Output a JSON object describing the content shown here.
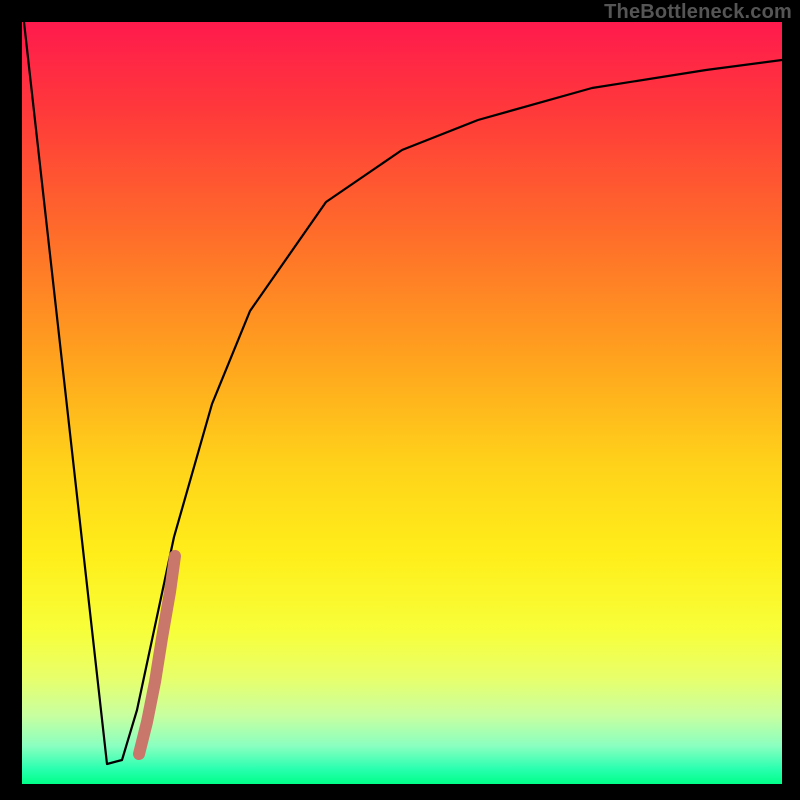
{
  "branding": "TheBottleneck.com",
  "chart_data": {
    "type": "line",
    "title": "",
    "xlabel": "",
    "ylabel": "",
    "xlim": [
      0,
      100
    ],
    "ylim": [
      0,
      100
    ],
    "series": [
      {
        "name": "bottleneck-curve",
        "x": [
          0,
          11.5,
          13,
          15,
          20,
          25,
          30,
          40,
          50,
          60,
          75,
          90,
          100
        ],
        "y": [
          100,
          2.5,
          3,
          10,
          33,
          50,
          62,
          76,
          83,
          87,
          91,
          93.5,
          95
        ]
      },
      {
        "name": "highlight-segment",
        "x": [
          15.5,
          16.5,
          17.5,
          18.5,
          19.5,
          20.0
        ],
        "y": [
          4,
          8,
          14,
          20,
          26,
          30
        ]
      }
    ],
    "gradient_stops": [
      {
        "pos": 0,
        "color": "#ff1a4d"
      },
      {
        "pos": 100,
        "color": "#00ff88"
      }
    ]
  }
}
